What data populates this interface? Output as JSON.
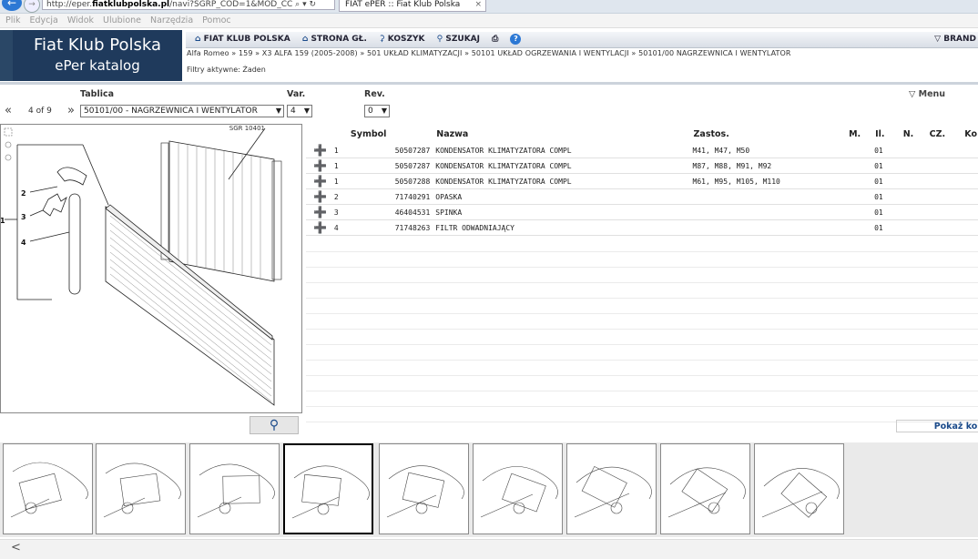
{
  "browser": {
    "url_prefix": "http://eper.",
    "url_domain": "fiatklubpolska.pl",
    "url_suffix": "/navi?SGRP_COD=1&MOD_CC",
    "url_icons": "⌕ ▾ ↻",
    "tab_title": "FIAT ePER :: Fiat Klub Polska",
    "tab_close": "×",
    "menu": [
      "Plik",
      "Edycja",
      "Widok",
      "Ulubione",
      "Narzędzia",
      "Pomoc"
    ]
  },
  "logo": {
    "line1": "Fiat Klub Polska",
    "line2": "ePer katalog"
  },
  "topnav": {
    "items": [
      {
        "icon": "home-icon",
        "label": "FIAT KLUB POLSKA"
      },
      {
        "icon": "home-icon",
        "label": "STRONA GŁ."
      },
      {
        "icon": "cart-icon",
        "label": "KOSZYK"
      },
      {
        "icon": "search-icon",
        "label": "SZUKAJ"
      }
    ],
    "brand": "▽ BRAND"
  },
  "breadcrumb": "Alfa Romeo » 159 » X3 ALFA 159 (2005-2008) » 501 UKŁAD KLIMATYZACJI » 50101 UKŁAD OGRZEWANIA I WENTYLACJI » 50101/00 NAGRZEWNICA I WENTYLATOR",
  "filters": "Filtry aktywne: Żaden",
  "selectors": {
    "tablica_label": "Tablica",
    "var_label": "Var.",
    "rev_label": "Rev.",
    "menu_label": "▽ Menu",
    "prev": "«",
    "next": "»",
    "position": "4 of 9",
    "tablica_value": "50101/00 - NAGRZEWNICA I WENTYLATOR",
    "var_value": "4",
    "rev_value": "0"
  },
  "diagram": {
    "sgr_label": "SGR 10401",
    "callouts": [
      "1",
      "2",
      "3",
      "4"
    ]
  },
  "table": {
    "headers": [
      "Symbol",
      "Nazwa",
      "Zastos.",
      "M.",
      "Il.",
      "N.",
      "CZ.",
      "Ko"
    ],
    "rows": [
      {
        "ref": "1",
        "symbol": "50507287",
        "name": "KONDENSATOR KLIMATYZATORA COMPL",
        "zastos": "M41, M47, M50",
        "il": "01"
      },
      {
        "ref": "1",
        "symbol": "50507287",
        "name": "KONDENSATOR KLIMATYZATORA COMPL",
        "zastos": "M87, M88, M91, M92",
        "il": "01"
      },
      {
        "ref": "1",
        "symbol": "50507288",
        "name": "KONDENSATOR KLIMATYZATORA COMPL",
        "zastos": "M61, M95, M105, M110",
        "il": "01"
      },
      {
        "ref": "2",
        "symbol": "71740291",
        "name": "OPASKA",
        "zastos": "",
        "il": "01"
      },
      {
        "ref": "3",
        "symbol": "46404531",
        "name": "SPINKA",
        "zastos": "",
        "il": "01"
      },
      {
        "ref": "4",
        "symbol": "71748263",
        "name": "FILTR ODWADNIAJĄCY",
        "zastos": "",
        "il": "01"
      }
    ]
  },
  "show_button": "Pokaż kos",
  "bottom_nav": "<"
}
